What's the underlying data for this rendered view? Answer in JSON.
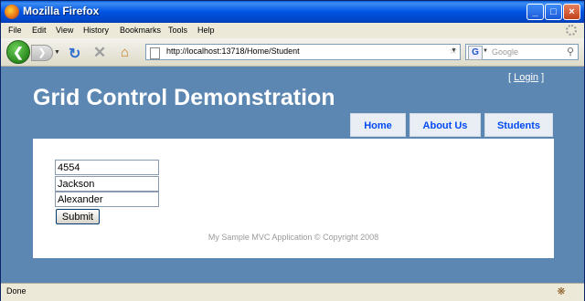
{
  "window": {
    "title": "Mozilla Firefox"
  },
  "menu": [
    "File",
    "Edit",
    "View",
    "History",
    "Bookmarks",
    "Tools",
    "Help"
  ],
  "toolbar": {
    "url": "http://localhost:13718/Home/Student",
    "search_placeholder": "Google"
  },
  "page": {
    "login_open": "[",
    "login_label": "Login",
    "login_close": "]",
    "heading": "Grid Control Demonstration",
    "tabs": [
      "Home",
      "About Us",
      "Students"
    ],
    "form": {
      "id_value": "4554",
      "last_name_value": "Jackson",
      "first_name_value": "Alexander",
      "submit_label": "Submit"
    },
    "footer": "My Sample MVC Application © Copyright 2008"
  },
  "status": {
    "text": "Done"
  },
  "colors": {
    "page_bg": "#5c87b2",
    "tab_text": "#034af3",
    "titlebar": "#0054e3"
  }
}
